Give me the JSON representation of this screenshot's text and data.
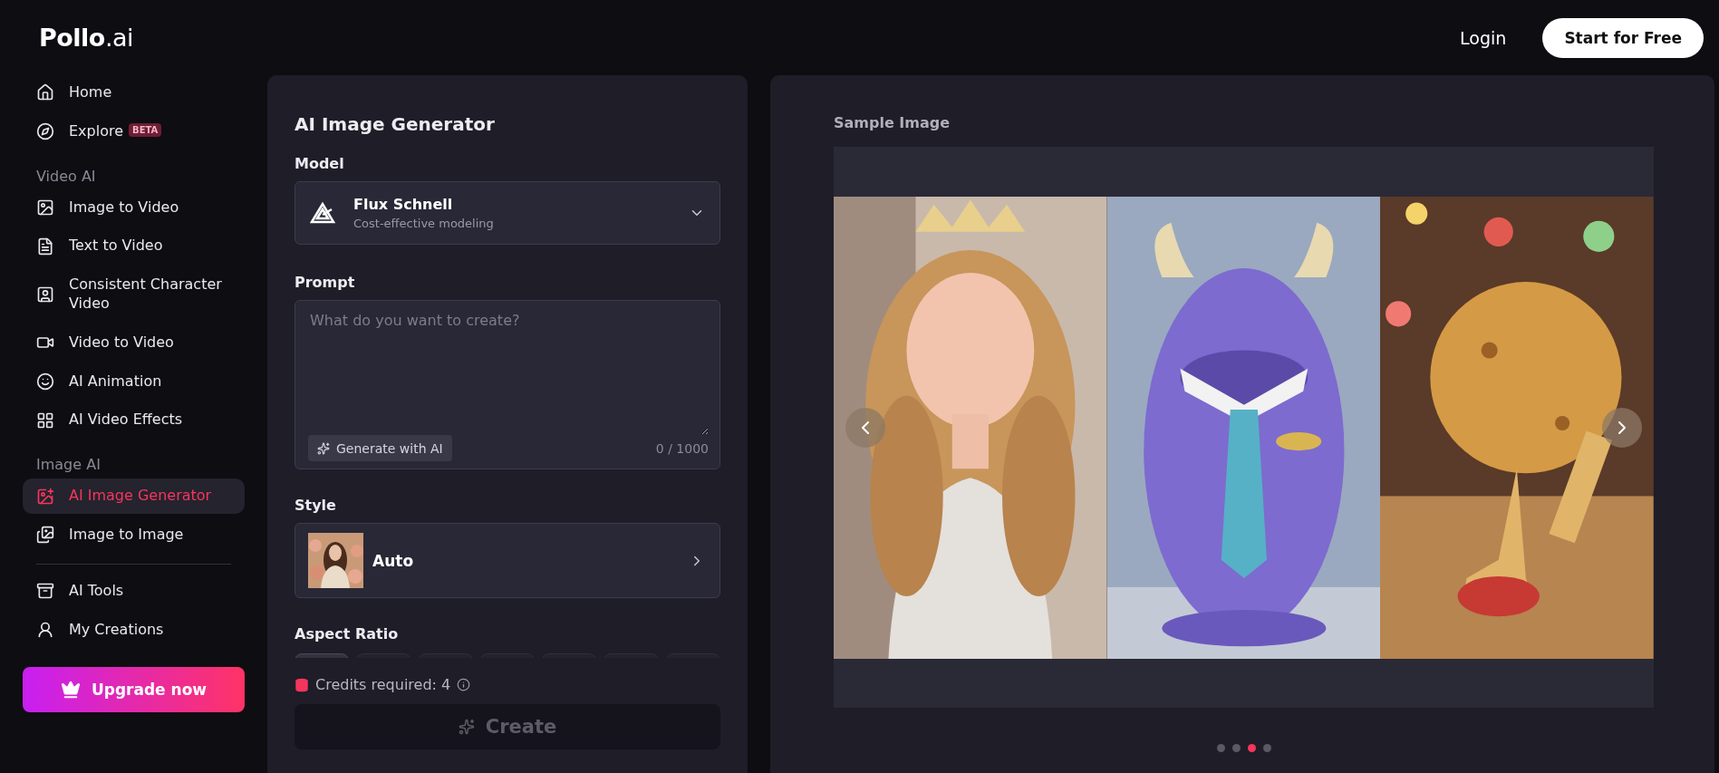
{
  "header": {
    "logo": "**Pollo**.ai",
    "login": "Login",
    "cta": "Start for Free"
  },
  "sidebar": {
    "top_items": [
      {
        "label": "Home",
        "selected": false
      },
      {
        "label": "Explore",
        "badge": "BETA",
        "selected": false
      }
    ],
    "sections": [
      {
        "title": "Video AI",
        "items": [
          {
            "label": "Image to Video",
            "selected": false
          },
          {
            "label": "Text to Video",
            "selected": false
          },
          {
            "label": "Consistent Character Video",
            "selected": false
          },
          {
            "label": "Video to Video",
            "selected": false
          },
          {
            "label": "AI Animation",
            "selected": false
          },
          {
            "label": "AI Video Effects",
            "selected": false
          }
        ]
      },
      {
        "title": "Image AI",
        "items": [
          {
            "label": "AI Image Generator",
            "selected": true
          },
          {
            "label": "Image to Image",
            "selected": false
          }
        ]
      }
    ],
    "bottom_items": [
      {
        "label": "AI Tools",
        "selected": false
      },
      {
        "label": "My Creations",
        "selected": false
      }
    ],
    "upgrade_button": "Upgrade now"
  },
  "generator": {
    "title": "AI Image Generator",
    "model": {
      "label": "Model",
      "name": "Flux Schnell",
      "description": "Cost-effective modeling"
    },
    "prompt": {
      "label": "Prompt",
      "placeholder": "What do you want to create?",
      "assist_button": "Generate with AI",
      "counter": "0 / 1000"
    },
    "style": {
      "label": "Style",
      "value": "Auto"
    },
    "aspect_ratio": {
      "label": "Aspect Ratio",
      "options": [
        {
          "selected": true
        },
        {
          "selected": false
        },
        {
          "selected": false
        },
        {
          "selected": false
        },
        {
          "selected": false
        },
        {
          "selected": false
        },
        {
          "selected": false
        }
      ]
    },
    "credits": "Credits required: 4",
    "create_button": {
      "label": "Create",
      "disabled": true
    }
  },
  "sample": {
    "title": "Sample Image",
    "dots": [
      {
        "selected": false
      },
      {
        "selected": false
      },
      {
        "selected": true
      },
      {
        "selected": false
      }
    ]
  }
}
